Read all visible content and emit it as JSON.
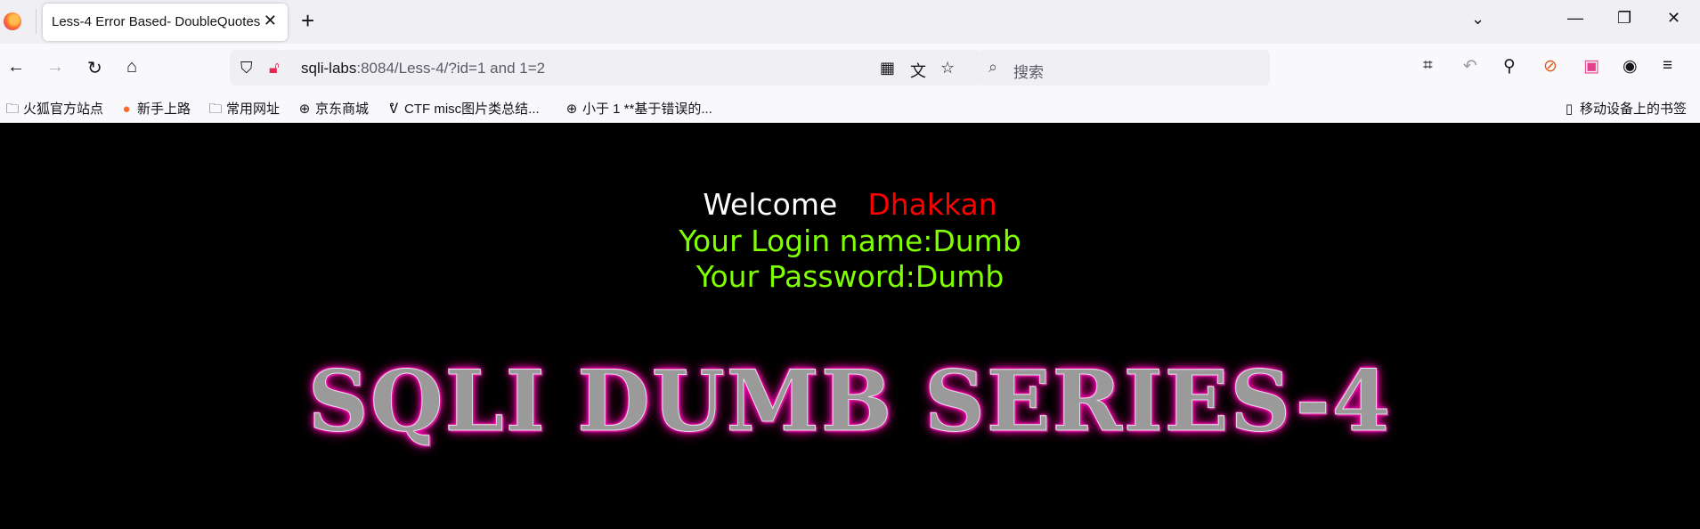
{
  "browser": {
    "tab_title": "Less-4 Error Based- DoubleQuotes",
    "tab_close": "✕",
    "new_tab": "+",
    "url_host": "sqli-labs",
    "url_rest": ":8084/Less-4/?id=1 and 1=2",
    "search_placeholder": "搜索",
    "window_controls": [
      "—",
      "❐",
      "✕"
    ]
  },
  "bookmarks": {
    "items": [
      {
        "label": "火狐官方站点",
        "icon": "folder-icon"
      },
      {
        "label": "新手上路",
        "icon": "firefox-icon"
      },
      {
        "label": "常用网址",
        "icon": "folder-icon"
      },
      {
        "label": "京东商城",
        "icon": "globe-icon"
      },
      {
        "label": "CTF misc图片类总结...",
        "icon": "page-icon"
      },
      {
        "label": "小于 1 **基于错误的...",
        "icon": "globe-icon"
      }
    ],
    "mobile": "移动设备上的书签"
  },
  "page": {
    "welcome": "Welcome",
    "username": "Dhakkan",
    "login_line": "Your Login name:Dumb",
    "password_line": "Your Password:Dumb",
    "banner": "SQLI DUMB SERIES-4"
  },
  "colors": {
    "welcome": "#ffffff",
    "username": "#ff0000",
    "info": "#7fff00",
    "banner_glow": "#ff00aa"
  }
}
